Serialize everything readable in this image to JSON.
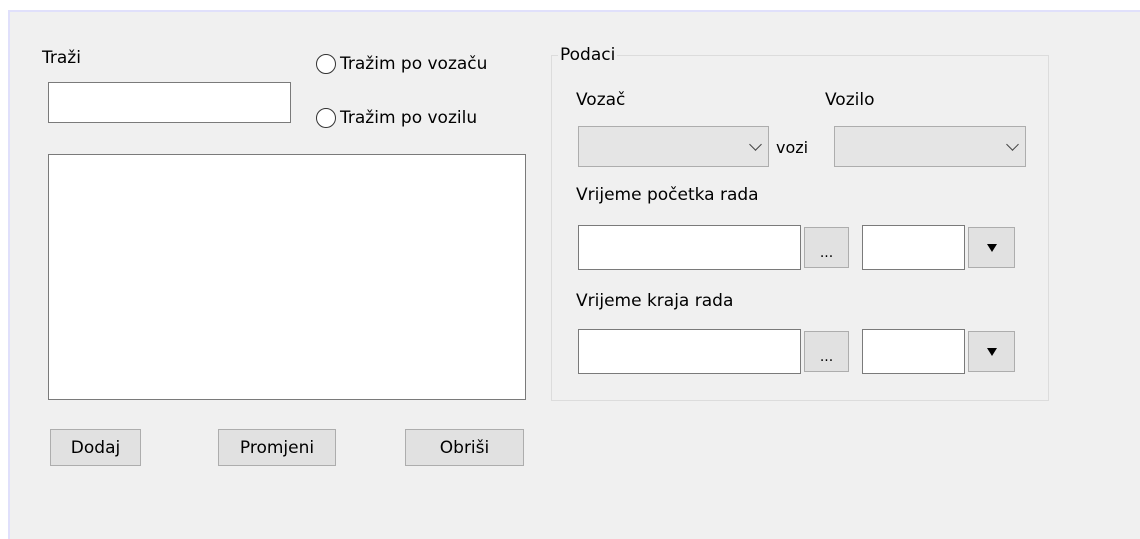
{
  "search": {
    "label": "Traži",
    "value": "",
    "radio_driver": "Tražim po vozaču",
    "radio_vehicle": "Tražim po vozilu"
  },
  "buttons": {
    "add": "Dodaj",
    "edit": "Promjeni",
    "delete": "Obriši"
  },
  "data_group": {
    "title": "Podaci",
    "driver_label": "Vozač",
    "vehicle_label": "Vozilo",
    "drives_label": "vozi",
    "driver_value": "",
    "vehicle_value": "",
    "start_label": "Vrijeme početka rada",
    "end_label": "Vrijeme kraja rada",
    "picker_button": "...",
    "start_date": "",
    "start_time": "",
    "end_date": "",
    "end_time": ""
  }
}
